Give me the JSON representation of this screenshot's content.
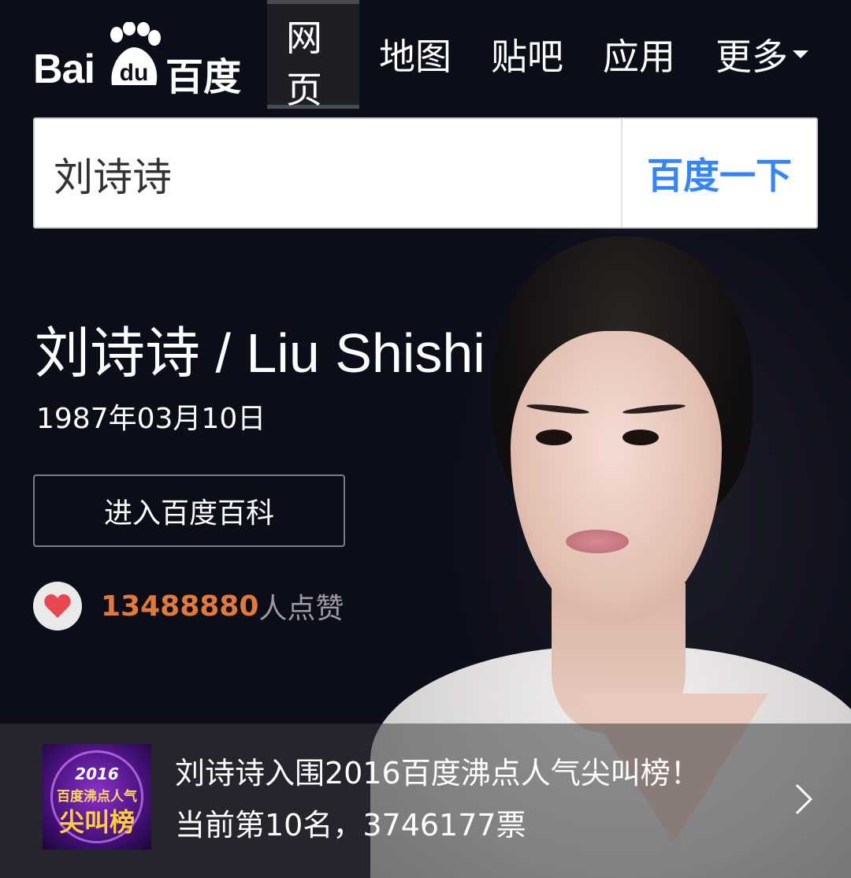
{
  "logo": {
    "latin": "Bai",
    "paw_letters": "du",
    "chinese": "百度"
  },
  "nav": [
    {
      "label": "网页",
      "active": true
    },
    {
      "label": "地图"
    },
    {
      "label": "贴吧"
    },
    {
      "label": "应用"
    },
    {
      "label": "更多"
    }
  ],
  "search": {
    "value": "刘诗诗",
    "button": "百度一下"
  },
  "person": {
    "title": "刘诗诗 / Liu Shishi",
    "birth": "1987年03月10日",
    "baike_button": "进入百度百科",
    "likes_count": "13488880",
    "likes_suffix": "人点赞"
  },
  "banner": {
    "badge_year": "2016",
    "badge_line2": "百度沸点人气",
    "badge_line3": "尖叫榜",
    "text": "刘诗诗入围2016百度沸点人气尖叫榜！当前第10名，3746177票"
  },
  "colors": {
    "accent": "#3385ff",
    "likes": "#e0793a",
    "heart": "#e8474f"
  }
}
